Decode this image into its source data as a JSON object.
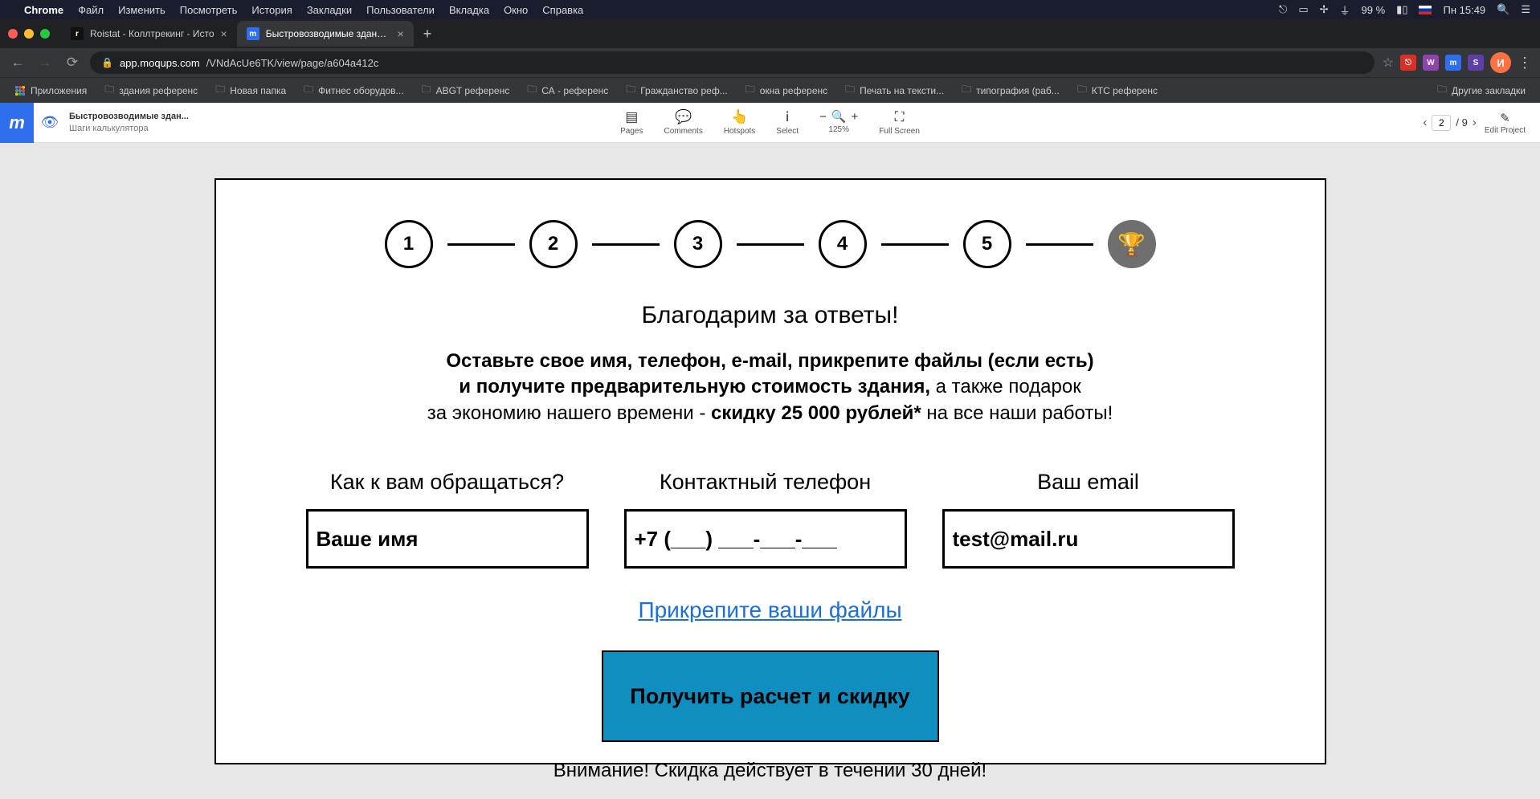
{
  "mac_menu": {
    "app": "Chrome",
    "items": [
      "Файл",
      "Изменить",
      "Посмотреть",
      "История",
      "Закладки",
      "Пользователи",
      "Вкладка",
      "Окно",
      "Справка"
    ],
    "battery": "99 %",
    "time": "Пн 15:49"
  },
  "tabs": {
    "tab1": "Roistat - Коллтрекинг - Исто",
    "tab2": "Быстровозводимые здания (К"
  },
  "url": {
    "domain": "app.moqups.com",
    "path": "/VNdAcUe6TK/view/page/a604a412c"
  },
  "avatar_letter": "И",
  "bookmarks": {
    "apps": "Приложения",
    "items": [
      "здания референс",
      "Новая папка",
      "Фитнес оборудов...",
      "ABGT референс",
      "СА - референс",
      "Гражданство реф...",
      "окна референс",
      "Печать на тексти...",
      "типография (раб...",
      "КТС референс"
    ],
    "other": "Другие закладки"
  },
  "app_toolbar": {
    "project_title": "Быстровозводимые здан...",
    "project_sub": "Шаги калькулятора",
    "pages": "Pages",
    "comments": "Comments",
    "hotspots": "Hotspots",
    "select": "Select",
    "zoom": "125%",
    "fullscreen": "Full Screen",
    "page_current": "2",
    "page_total": "/ 9",
    "edit": "Edit Project"
  },
  "mock": {
    "steps": [
      "1",
      "2",
      "3",
      "4",
      "5"
    ],
    "headline": "Благодарим за ответы!",
    "sub_bold1": "Оставьте свое имя, телефон, e-mail, прикрепите файлы (если есть)",
    "sub_bold2": "и получите предварительную стоимость здания,",
    "sub_plain2": " а также подарок",
    "sub_line3a": "за экономию нашего времени - ",
    "sub_bold3": "скидку 25 000 рублей*",
    "sub_line3b": " на все наши работы!",
    "field_name_label": "Как к вам обращаться?",
    "field_name_ph": "Ваше имя",
    "field_phone_label": "Контактный телефон",
    "field_phone_ph": "+7 (___) ___-___-___",
    "field_email_label": "Ваш email",
    "field_email_ph": "test@mail.ru",
    "attach": "Прикрепите ваши файлы",
    "submit": "Получить расчет и скидку",
    "notice": "Внимание! Скидка действует в течении 30 дней!"
  }
}
